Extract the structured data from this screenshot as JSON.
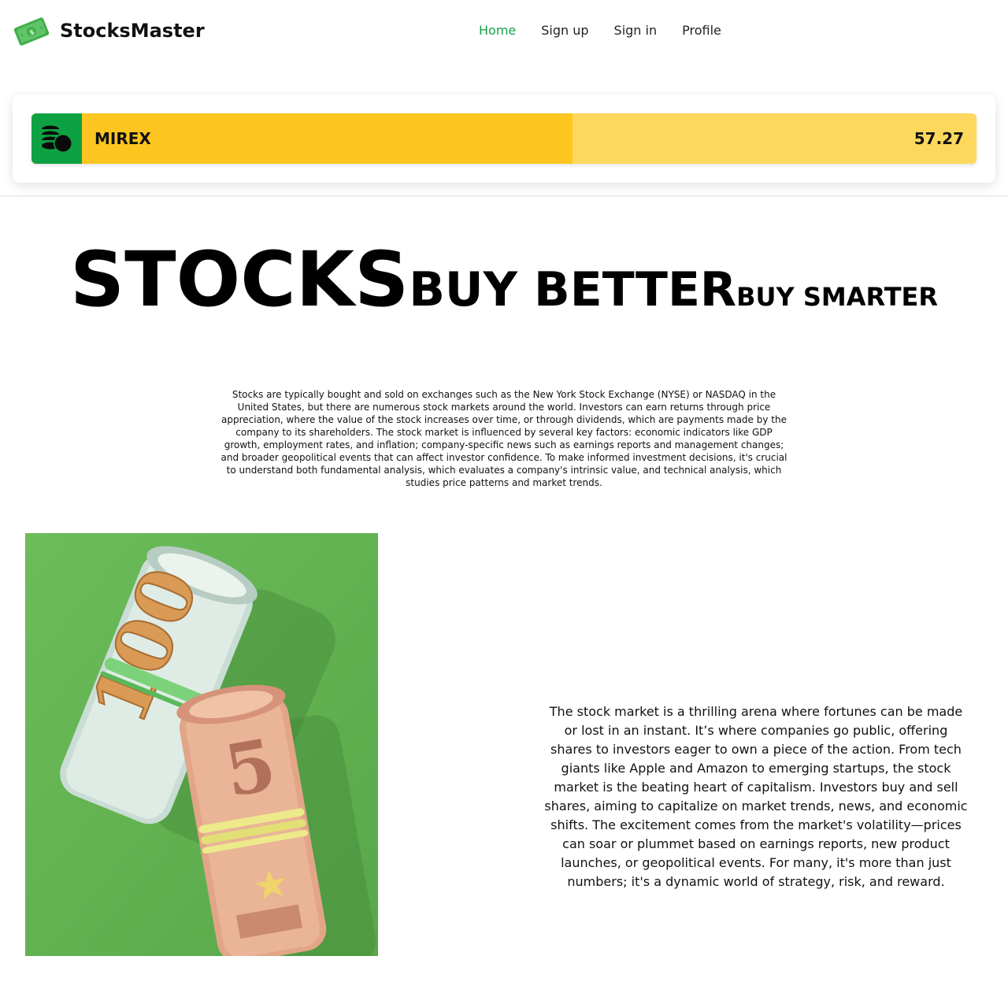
{
  "header": {
    "brand": "StocksMaster",
    "logo_icon": "money-bill-icon",
    "nav": [
      {
        "label": "Home",
        "active": true
      },
      {
        "label": "Sign up",
        "active": false
      },
      {
        "label": "Sign in",
        "active": false
      },
      {
        "label": "Profile",
        "active": false
      }
    ]
  },
  "ticker": {
    "icon": "coins-icon",
    "symbol": "MIREX",
    "value": "57.27",
    "fill_fraction": 0.5727
  },
  "hero": {
    "word1": "STOCKS",
    "word2": "BUY BETTER",
    "word3": "BUY SMARTER"
  },
  "intro_text": "Stocks are typically bought and sold on exchanges such as the New York Stock Exchange (NYSE) or NASDAQ in the United States, but there are numerous stock markets around the world. Investors can earn returns through price appreciation, where the value of the stock increases over time, or through dividends, which are payments made by the company to its shareholders. The stock market is influenced by several key factors: economic indicators like GDP growth, employment rates, and inflation; company-specific news such as earnings reports and management changes; and broader geopolitical events that can affect investor confidence. To make informed investment decisions, it's crucial to understand both fundamental analysis, which evaluates a company's intrinsic value, and technical analysis, which studies price patterns and market trends.",
  "photo": {
    "subject": "rolled-banknotes-image"
  },
  "story_text": "The stock market is a thrilling arena where fortunes can be made or lost in an instant. It’s where companies go public, offering shares to investors eager to own a piece of the action. From tech giants like Apple and Amazon to emerging startups, the stock market is the beating heart of capitalism. Investors buy and sell shares, aiming to capitalize on market trends, news, and economic shifts. The excitement comes from the market's volatility—prices can soar or plummet based on earnings reports, new product launches, or geopolitical events. For many, it's more than just numbers; it's a dynamic world of strategy, risk, and reward.",
  "colors": {
    "accent_green": "#16a34a",
    "ticker_green": "#0ea144",
    "ticker_fill": "#fcc520",
    "ticker_track": "#fdd85d"
  }
}
